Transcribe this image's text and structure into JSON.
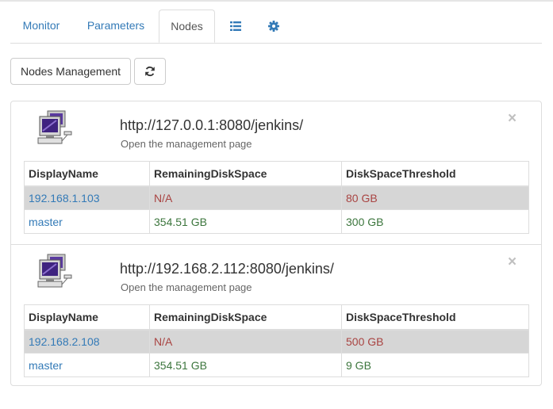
{
  "tabs": [
    {
      "label": "Monitor",
      "icon": null
    },
    {
      "label": "Parameters",
      "icon": null
    },
    {
      "label": "Nodes",
      "icon": null,
      "active": true
    },
    {
      "label": "",
      "icon": "list-icon"
    },
    {
      "label": "",
      "icon": "gear-icon"
    }
  ],
  "toolbar": {
    "nodes_management_label": "Nodes Management",
    "refresh_icon": "refresh-icon"
  },
  "table_headers": [
    "DisplayName",
    "RemainingDiskSpace",
    "DiskSpaceThreshold"
  ],
  "nodes": [
    {
      "url": "http://127.0.0.1:8080/jenkins/",
      "subtitle": "Open the management page",
      "close": "×",
      "rows": [
        {
          "name": "192.168.1.103",
          "remaining": "N/A",
          "threshold": "80 GB",
          "status": "warning"
        },
        {
          "name": "master",
          "remaining": "354.51 GB",
          "threshold": "300 GB",
          "status": "ok"
        }
      ]
    },
    {
      "url": "http://192.168.2.112:8080/jenkins/",
      "subtitle": "Open the management page",
      "close": "×",
      "rows": [
        {
          "name": "192.168.2.108",
          "remaining": "N/A",
          "threshold": "500 GB",
          "status": "warning"
        },
        {
          "name": "master",
          "remaining": "354.51 GB",
          "threshold": "9 GB",
          "status": "ok"
        }
      ]
    }
  ],
  "colors": {
    "link": "#337ab7",
    "warning_text": "#a94442",
    "ok_text": "#3c763d",
    "warning_row_bg": "#d6d6d6"
  }
}
